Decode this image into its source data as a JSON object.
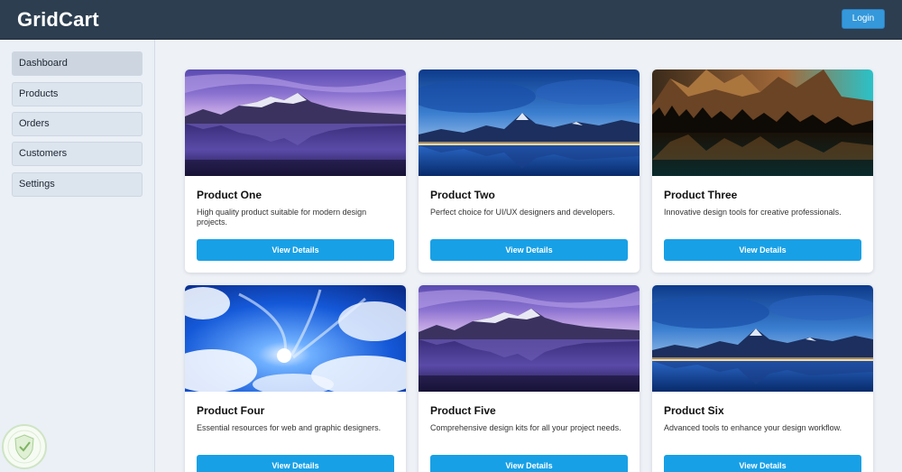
{
  "app": {
    "title": "GridCart"
  },
  "header": {
    "login_label": "Login"
  },
  "sidebar": {
    "items": [
      {
        "label": "Dashboard"
      },
      {
        "label": "Products"
      },
      {
        "label": "Orders"
      },
      {
        "label": "Customers"
      },
      {
        "label": "Settings"
      }
    ]
  },
  "products": [
    {
      "title": "Product One",
      "description": "High quality product suitable for modern design projects.",
      "button": "View Details",
      "image": "mountain-lake-dusk-image"
    },
    {
      "title": "Product Two",
      "description": "Perfect choice for UI/UX designers and developers.",
      "button": "View Details",
      "image": "blue-fjord-town-image"
    },
    {
      "title": "Product Three",
      "description": "Innovative design tools for creative professionals.",
      "button": "View Details",
      "image": "dolomites-forest-lake-image"
    },
    {
      "title": "Product Four",
      "description": "Essential resources for web and graphic designers.",
      "button": "View Details",
      "image": "blue-sky-clouds-image"
    },
    {
      "title": "Product Five",
      "description": "Comprehensive design kits for all your project needs.",
      "button": "View Details",
      "image": "mountain-lake-dusk-image"
    },
    {
      "title": "Product Six",
      "description": "Advanced tools to enhance your design workflow.",
      "button": "View Details",
      "image": "blue-fjord-town-image"
    }
  ],
  "colors": {
    "header_bg": "#2d3e50",
    "accent": "#3498db",
    "button": "#18a0e6",
    "sidebar_bg": "#eaf0f6",
    "page_bg": "#eef2f7"
  }
}
